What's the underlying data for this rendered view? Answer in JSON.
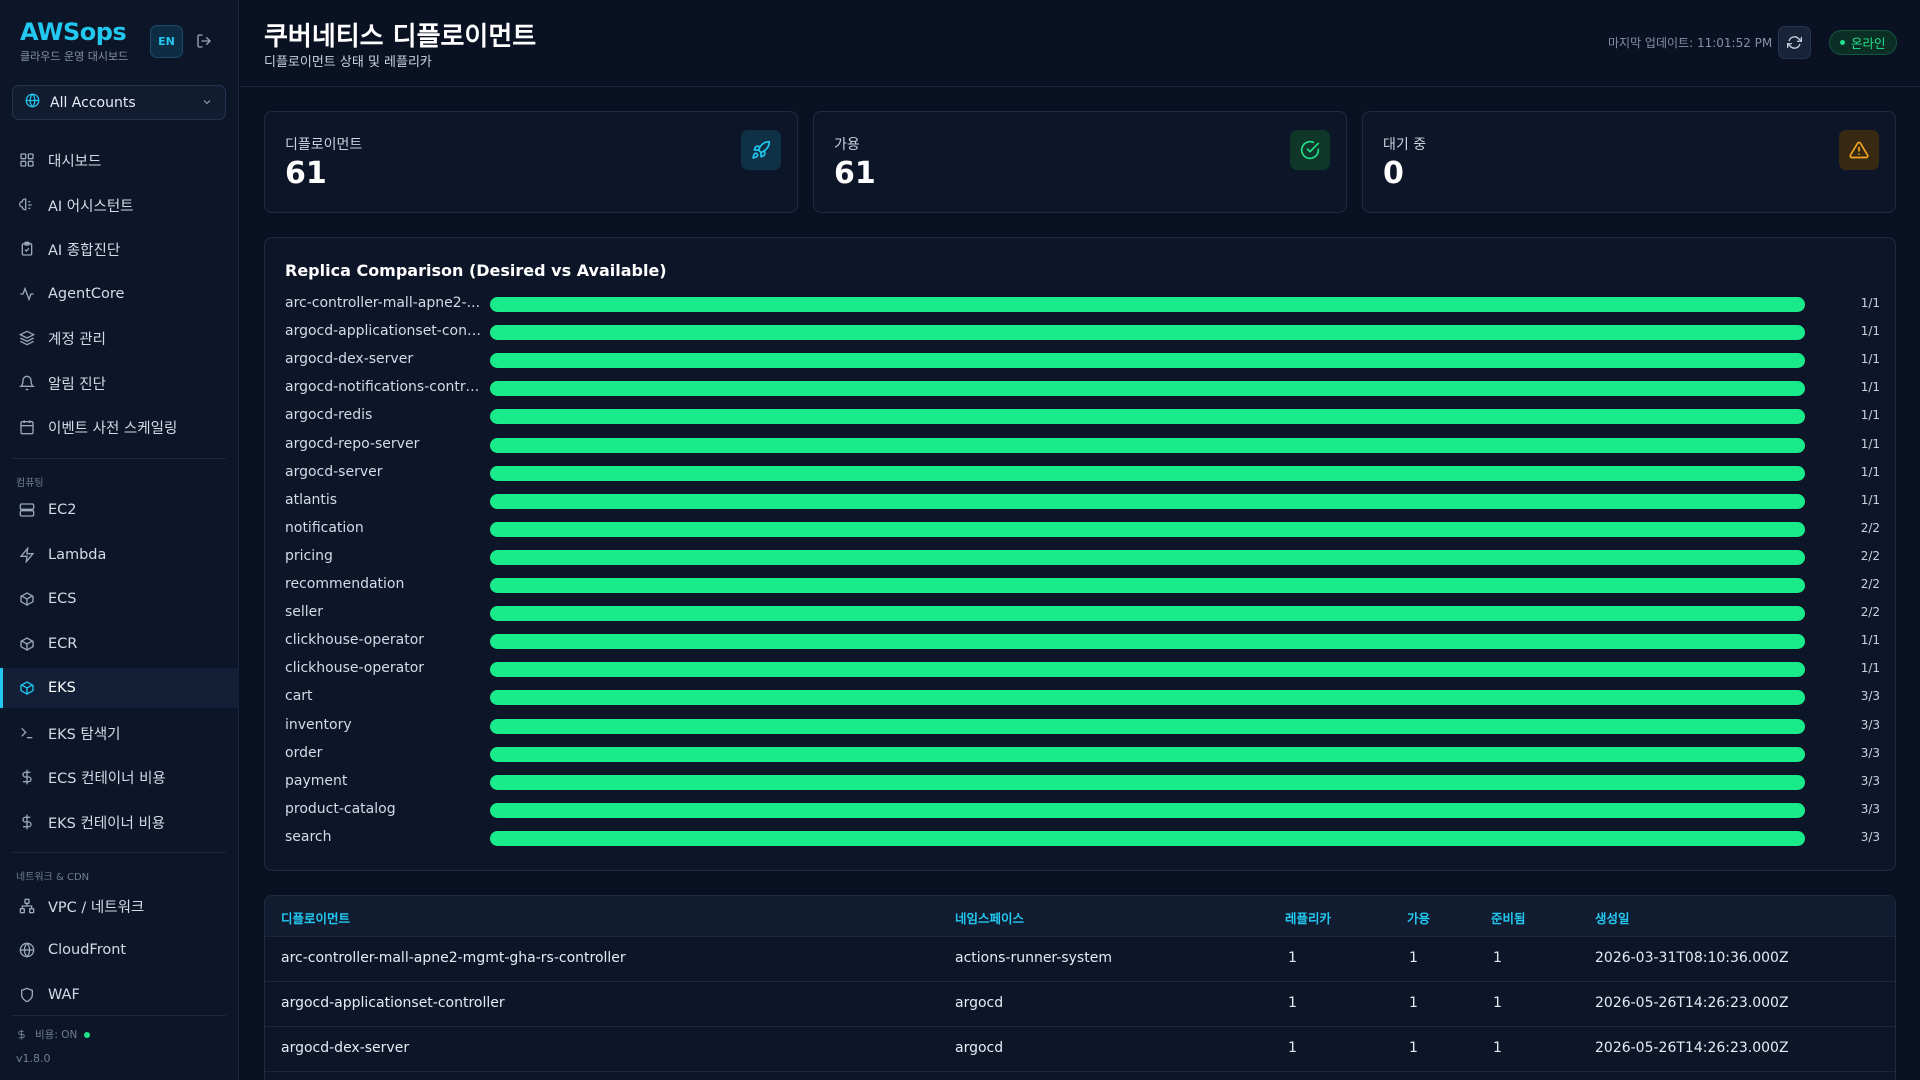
{
  "sidebar": {
    "brand_title": "AWSops",
    "brand_sub": "클라우드 운영 대시보드",
    "lang": "EN",
    "account": "All Accounts",
    "items": [
      {
        "label": "대시보드",
        "icon": "grid-icon"
      },
      {
        "label": "AI 어시스턴트",
        "icon": "brain-icon"
      },
      {
        "label": "AI 종합진단",
        "icon": "clipboard-check-icon"
      },
      {
        "label": "AgentCore",
        "icon": "activity-icon"
      },
      {
        "label": "계정 관리",
        "icon": "layers-icon"
      },
      {
        "label": "알림 진단",
        "icon": "bell-icon"
      },
      {
        "label": "이벤트 사전 스케일링",
        "icon": "calendar-icon"
      },
      {
        "label": "EC2",
        "icon": "server-icon"
      },
      {
        "label": "Lambda",
        "icon": "bolt-icon"
      },
      {
        "label": "ECS",
        "icon": "box-icon"
      },
      {
        "label": "ECR",
        "icon": "box-icon"
      },
      {
        "label": "EKS",
        "icon": "box-icon"
      },
      {
        "label": "EKS 탐색기",
        "icon": "terminal-icon"
      },
      {
        "label": "ECS 컨테이너 비용",
        "icon": "dollar-icon"
      },
      {
        "label": "EKS 컨테이너 비용",
        "icon": "dollar-icon"
      },
      {
        "label": "VPC / 네트워크",
        "icon": "network-icon"
      },
      {
        "label": "CloudFront",
        "icon": "globe-icon"
      },
      {
        "label": "WAF",
        "icon": "shield-icon"
      }
    ],
    "sections": {
      "compute": "컴퓨팅",
      "network": "네트워크 & CDN"
    },
    "cost_label": "비용: ON",
    "version": "v1.8.0"
  },
  "header": {
    "title": "쿠버네티스 디플로이먼트",
    "subtitle": "디플로이먼트 상태 및 레플리카",
    "last_update": "마지막 업데이트: 11:01:52 PM",
    "status": "온라인"
  },
  "stats": [
    {
      "label": "디플로이먼트",
      "value": "61",
      "icon": "rocket-icon",
      "color": "#22c8f0"
    },
    {
      "label": "가용",
      "value": "61",
      "icon": "check-circle-icon",
      "color": "#22e08a"
    },
    {
      "label": "대기 중",
      "value": "0",
      "icon": "warning-icon",
      "color": "#f5a623"
    }
  ],
  "chart_data": {
    "type": "bar",
    "title": "Replica Comparison (Desired vs Available)",
    "categories": [
      "arc-controller-mall-apne2-...",
      "argocd-applicationset-cont...",
      "argocd-dex-server",
      "argocd-notifications-contro...",
      "argocd-redis",
      "argocd-repo-server",
      "argocd-server",
      "atlantis",
      "notification",
      "pricing",
      "recommendation",
      "seller",
      "clickhouse-operator",
      "clickhouse-operator",
      "cart",
      "inventory",
      "order",
      "payment",
      "product-catalog",
      "search"
    ],
    "series": [
      {
        "name": "Desired",
        "values": [
          1,
          1,
          1,
          1,
          1,
          1,
          1,
          1,
          2,
          2,
          2,
          2,
          1,
          1,
          3,
          3,
          3,
          3,
          3,
          3
        ]
      },
      {
        "name": "Available",
        "values": [
          1,
          1,
          1,
          1,
          1,
          1,
          1,
          1,
          2,
          2,
          2,
          2,
          1,
          1,
          3,
          3,
          3,
          3,
          3,
          3
        ]
      }
    ],
    "labels": [
      "1/1",
      "1/1",
      "1/1",
      "1/1",
      "1/1",
      "1/1",
      "1/1",
      "1/1",
      "2/2",
      "2/2",
      "2/2",
      "2/2",
      "1/1",
      "1/1",
      "3/3",
      "3/3",
      "3/3",
      "3/3",
      "3/3",
      "3/3"
    ],
    "bar_color": "#1aeb8a"
  },
  "table": {
    "columns": [
      "디플로이먼트",
      "네임스페이스",
      "레플리카",
      "가용",
      "준비됨",
      "생성일"
    ],
    "rows": [
      [
        "arc-controller-mall-apne2-mgmt-gha-rs-controller",
        "actions-runner-system",
        "1",
        "1",
        "1",
        "2026-03-31T08:10:36.000Z"
      ],
      [
        "argocd-applicationset-controller",
        "argocd",
        "1",
        "1",
        "1",
        "2026-05-26T14:26:23.000Z"
      ],
      [
        "argocd-dex-server",
        "argocd",
        "1",
        "1",
        "1",
        "2026-05-26T14:26:23.000Z"
      ]
    ]
  }
}
